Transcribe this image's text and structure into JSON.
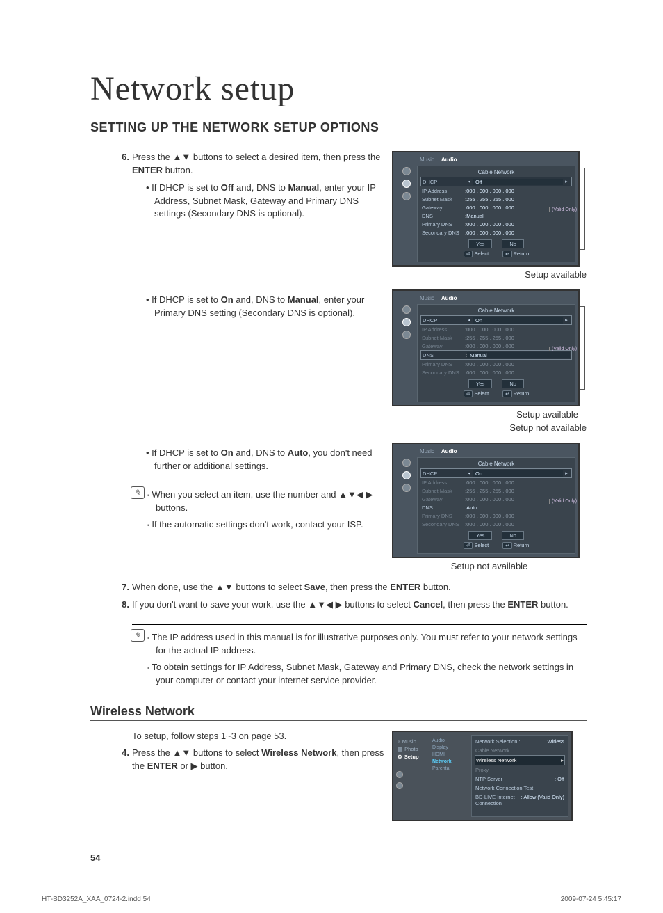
{
  "page_number": "54",
  "main_title": "Network setup",
  "section_title": "SETTING UP THE NETWORK SETUP OPTIONS",
  "step6": {
    "num": "6.",
    "text_prefix": "Press the ",
    "arrows1": "▲▼",
    "text_mid": " buttons to select a desired item, then press the ",
    "bold1": "ENTER",
    "text_suffix": " button."
  },
  "bullet6a": {
    "p1": "If DHCP is set to ",
    "b1": "Off",
    "p2": " and, DNS to ",
    "b2": "Manual",
    "p3": ", enter your IP Address, Subnet Mask, Gateway and Primary DNS settings (Secondary DNS is optional)."
  },
  "caption1": "Setup available",
  "bullet6b": {
    "p1": "If DHCP is set to ",
    "b1": "On",
    "p2": " and, DNS to ",
    "b2": "Manual",
    "p3": ", enter your Primary DNS setting (Secondary DNS is optional)."
  },
  "caption2a": "Setup available",
  "caption2b": "Setup not available",
  "bullet6c": {
    "p1": "If DHCP is set to ",
    "b1": "On",
    "p2": " and, DNS to ",
    "b2": "Auto",
    "p3": ", you don't need further or additional settings."
  },
  "caption3": "Setup not available",
  "note1": {
    "item1_p1": "When you select an item, use the number and ",
    "item1_arrows": "▲▼◀ ▶",
    "item1_p2": " buttons.",
    "item2": "If the automatic settings don't work, contact your ISP."
  },
  "step7": {
    "num": "7.",
    "p1": "When done, use the ",
    "arrows": "▲▼",
    "p2": " buttons to select ",
    "b1": "Save",
    "p3": ", then press the ",
    "b2": "ENTER",
    "p4": " button."
  },
  "step8": {
    "num": "8.",
    "p1": "If you don't want to save your work, use the ",
    "arrows": "▲▼◀ ▶",
    "p2": " buttons to select ",
    "b1": "Cancel",
    "p3": ", then press the ",
    "b2": "ENTER",
    "p4": " button."
  },
  "note2": {
    "item1": "The IP address used in this manual is for illustrative purposes only. You must refer to your network settings for the actual IP address.",
    "item2": "To obtain settings for IP Address, Subnet Mask, Gateway and Primary DNS, check the network settings in your computer or contact your internet service provider."
  },
  "subsection_title": "Wireless Network",
  "sub_intro": "To setup, follow steps 1~3 on page 53.",
  "step4": {
    "num": "4.",
    "p1": "Press the ",
    "arrows": "▲▼",
    "p2": " buttons to select ",
    "b1": "Wireless Network",
    "p3": ", then press the ",
    "b2": "ENTER",
    "p4": " or ",
    "arrow2": "▶",
    "p5": " button."
  },
  "footer_left": "HT-BD3252A_XAA_0724-2.indd   54",
  "footer_right": "2009-07-24   5:45:17",
  "osd": {
    "tab_music": "Music",
    "tab_audio": "Audio",
    "panel_title": "Cable Network",
    "dhcp": "DHCP",
    "ip": "IP Address",
    "mask": "Subnet Mask",
    "gw": "Gateway",
    "dns": "DNS",
    "pdns": "Primary DNS",
    "sdns": "Secondary DNS",
    "off": "Off",
    "on": "On",
    "manual": "Manual",
    "auto": "Auto",
    "val0": "000 . 000 . 000 . 000",
    "valmask": "255 . 255 . 255 . 000",
    "yes": "Yes",
    "no": "No",
    "select": "Select",
    "return": "Return",
    "valid": "(Valid Only)"
  },
  "osd2": {
    "side_music": "Music",
    "side_photo": "Photo",
    "side_setup": "Setup",
    "mid_audio": "Audio",
    "mid_display": "Display",
    "mid_hdmi": "HDMI",
    "mid_network": "Network",
    "mid_parental": "Parental",
    "r_netsel_k": "Network Selection :",
    "r_netsel_v": "Wirless",
    "r_cable": "Cable Network",
    "r_wireless": "Wireless Network",
    "r_proxy": "Proxy",
    "r_ntp_k": "NTP Server",
    "r_ntp_v": ": Off",
    "r_test": "Network Connection Test",
    "r_bdlive_k": "BD-LIVE Internet Connection",
    "r_bdlive_v": ": Allow (Valid Only)"
  }
}
